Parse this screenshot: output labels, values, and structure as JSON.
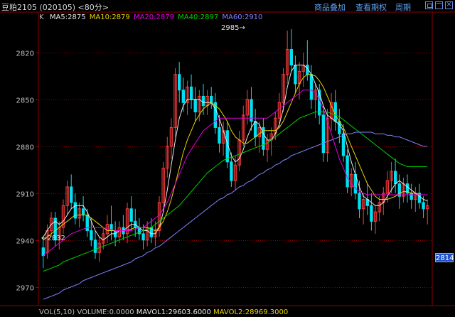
{
  "window": {
    "title": "豆粕2105 (020105) <80分>",
    "buttons": {
      "overlay": "商品叠加",
      "futures": "查看期权",
      "close": "周期"
    }
  },
  "indicator": {
    "k_label": "K",
    "ma": [
      {
        "name": "MA5",
        "text": "MA5:2875",
        "value": 2875,
        "color": "#e8e8e8"
      },
      {
        "name": "MA10",
        "text": "MA10:2879",
        "value": 2879,
        "color": "#e8d400"
      },
      {
        "name": "MA20",
        "text": "MA20:2879",
        "value": 2879,
        "color": "#e000e0"
      },
      {
        "name": "MA40",
        "text": "MA40:2897",
        "value": 2897,
        "color": "#00d000"
      },
      {
        "name": "MA60",
        "text": "MA60:2910",
        "value": 2910,
        "color": "#8080ff"
      }
    ]
  },
  "annotations": {
    "high": "2985",
    "low": "2832"
  },
  "price_axis": {
    "ticks": [
      "2970",
      "2940",
      "2910",
      "2880",
      "2850",
      "2820"
    ],
    "current": "2814"
  },
  "volume_legend": {
    "vol": "VOL(5,10)",
    "volume": "VOLUME:0.0000",
    "mavol1": "MAVOL1:29603.6000",
    "mavol2": "MAVOL2:28969.3000"
  },
  "colors": {
    "up": "#ff3c3c",
    "down": "#00e0f0",
    "grid": "#8c0000",
    "axis_text": "#c0c0c0",
    "tag_bg": "#1f50c8"
  },
  "chart_data": {
    "type": "candlestick",
    "ylim": [
      2808,
      2990
    ],
    "yticks": [
      2820,
      2850,
      2880,
      2910,
      2940,
      2970
    ],
    "candles": [
      [
        2845,
        2852,
        2832,
        2840
      ],
      [
        2842,
        2860,
        2838,
        2856
      ],
      [
        2856,
        2868,
        2852,
        2864
      ],
      [
        2864,
        2868,
        2846,
        2850
      ],
      [
        2850,
        2862,
        2844,
        2858
      ],
      [
        2858,
        2876,
        2854,
        2872
      ],
      [
        2872,
        2888,
        2866,
        2884
      ],
      [
        2884,
        2892,
        2870,
        2874
      ],
      [
        2874,
        2880,
        2860,
        2864
      ],
      [
        2864,
        2874,
        2858,
        2870
      ],
      [
        2870,
        2878,
        2862,
        2866
      ],
      [
        2866,
        2870,
        2852,
        2856
      ],
      [
        2856,
        2864,
        2846,
        2850
      ],
      [
        2850,
        2856,
        2838,
        2842
      ],
      [
        2842,
        2852,
        2836,
        2848
      ],
      [
        2848,
        2858,
        2844,
        2854
      ],
      [
        2854,
        2866,
        2848,
        2860
      ],
      [
        2860,
        2872,
        2850,
        2856
      ],
      [
        2856,
        2862,
        2846,
        2852
      ],
      [
        2852,
        2862,
        2848,
        2858
      ],
      [
        2858,
        2866,
        2850,
        2854
      ],
      [
        2854,
        2874,
        2848,
        2870
      ],
      [
        2870,
        2878,
        2856,
        2862
      ],
      [
        2862,
        2870,
        2852,
        2858
      ],
      [
        2858,
        2864,
        2850,
        2854
      ],
      [
        2854,
        2860,
        2844,
        2850
      ],
      [
        2850,
        2862,
        2846,
        2858
      ],
      [
        2858,
        2864,
        2848,
        2852
      ],
      [
        2852,
        2862,
        2846,
        2856
      ],
      [
        2856,
        2878,
        2852,
        2874
      ],
      [
        2874,
        2900,
        2868,
        2896
      ],
      [
        2896,
        2916,
        2890,
        2910
      ],
      [
        2910,
        2928,
        2902,
        2922
      ],
      [
        2922,
        2960,
        2916,
        2956
      ],
      [
        2956,
        2964,
        2938,
        2946
      ],
      [
        2946,
        2954,
        2932,
        2938
      ],
      [
        2938,
        2952,
        2930,
        2948
      ],
      [
        2948,
        2956,
        2934,
        2940
      ],
      [
        2940,
        2948,
        2926,
        2932
      ],
      [
        2932,
        2946,
        2926,
        2942
      ],
      [
        2942,
        2950,
        2930,
        2936
      ],
      [
        2936,
        2946,
        2930,
        2942
      ],
      [
        2942,
        2948,
        2934,
        2938
      ],
      [
        2938,
        2944,
        2918,
        2922
      ],
      [
        2922,
        2930,
        2906,
        2912
      ],
      [
        2912,
        2926,
        2904,
        2920
      ],
      [
        2920,
        2926,
        2896,
        2900
      ],
      [
        2900,
        2906,
        2884,
        2888
      ],
      [
        2888,
        2904,
        2882,
        2898
      ],
      [
        2898,
        2920,
        2894,
        2914
      ],
      [
        2914,
        2936,
        2910,
        2930
      ],
      [
        2930,
        2946,
        2924,
        2940
      ],
      [
        2940,
        2948,
        2920,
        2926
      ],
      [
        2926,
        2934,
        2910,
        2916
      ],
      [
        2916,
        2926,
        2906,
        2922
      ],
      [
        2922,
        2928,
        2904,
        2908
      ],
      [
        2908,
        2918,
        2900,
        2914
      ],
      [
        2914,
        2922,
        2904,
        2918
      ],
      [
        2918,
        2932,
        2914,
        2928
      ],
      [
        2928,
        2944,
        2922,
        2938
      ],
      [
        2938,
        2960,
        2932,
        2956
      ],
      [
        2956,
        2984,
        2950,
        2972
      ],
      [
        2972,
        2985,
        2958,
        2962
      ],
      [
        2962,
        2968,
        2944,
        2950
      ],
      [
        2950,
        2964,
        2940,
        2958
      ],
      [
        2958,
        2970,
        2948,
        2962
      ],
      [
        2962,
        2978,
        2952,
        2956
      ],
      [
        2956,
        2962,
        2934,
        2940
      ],
      [
        2940,
        2950,
        2928,
        2946
      ],
      [
        2946,
        2950,
        2924,
        2930
      ],
      [
        2930,
        2936,
        2900,
        2906
      ],
      [
        2906,
        2934,
        2900,
        2928
      ],
      [
        2928,
        2944,
        2920,
        2938
      ],
      [
        2938,
        2946,
        2920,
        2926
      ],
      [
        2926,
        2934,
        2912,
        2918
      ],
      [
        2918,
        2924,
        2900,
        2904
      ],
      [
        2904,
        2908,
        2880,
        2884
      ],
      [
        2884,
        2896,
        2878,
        2892
      ],
      [
        2892,
        2900,
        2876,
        2880
      ],
      [
        2880,
        2888,
        2864,
        2870
      ],
      [
        2870,
        2880,
        2860,
        2876
      ],
      [
        2876,
        2886,
        2866,
        2872
      ],
      [
        2872,
        2880,
        2856,
        2862
      ],
      [
        2862,
        2872,
        2854,
        2868
      ],
      [
        2868,
        2878,
        2862,
        2874
      ],
      [
        2874,
        2884,
        2866,
        2880
      ],
      [
        2880,
        2894,
        2874,
        2888
      ],
      [
        2888,
        2900,
        2880,
        2894
      ],
      [
        2894,
        2902,
        2880,
        2886
      ],
      [
        2886,
        2892,
        2870,
        2878
      ],
      [
        2878,
        2890,
        2874,
        2886
      ],
      [
        2886,
        2892,
        2874,
        2880
      ],
      [
        2880,
        2886,
        2870,
        2876
      ],
      [
        2876,
        2884,
        2868,
        2880
      ],
      [
        2880,
        2886,
        2870,
        2874
      ],
      [
        2874,
        2878,
        2864,
        2870
      ],
      [
        2870,
        2876,
        2860,
        2872
      ]
    ],
    "ma_lines": {
      "MA5": [
        2852,
        2856,
        2860,
        2862,
        2860,
        2862,
        2866,
        2870,
        2872,
        2872,
        2872,
        2868,
        2862,
        2856,
        2852,
        2850,
        2852,
        2854,
        2854,
        2856,
        2856,
        2858,
        2860,
        2860,
        2858,
        2856,
        2856,
        2854,
        2854,
        2858,
        2868,
        2882,
        2898,
        2914,
        2928,
        2936,
        2940,
        2940,
        2940,
        2940,
        2938,
        2938,
        2938,
        2934,
        2928,
        2920,
        2912,
        2904,
        2900,
        2902,
        2908,
        2916,
        2922,
        2926,
        2924,
        2918,
        2914,
        2914,
        2918,
        2924,
        2934,
        2948,
        2958,
        2962,
        2962,
        2962,
        2960,
        2956,
        2950,
        2944,
        2936,
        2930,
        2928,
        2926,
        2924,
        2920,
        2910,
        2900,
        2892,
        2884,
        2878,
        2876,
        2874,
        2872,
        2872,
        2874,
        2878,
        2882,
        2886,
        2888,
        2886,
        2884,
        2882,
        2880,
        2878,
        2876,
        2875
      ],
      "MA10": [
        2850,
        2852,
        2854,
        2856,
        2858,
        2860,
        2862,
        2864,
        2866,
        2866,
        2866,
        2866,
        2864,
        2862,
        2860,
        2858,
        2856,
        2856,
        2856,
        2856,
        2856,
        2856,
        2857,
        2858,
        2858,
        2858,
        2858,
        2857,
        2856,
        2858,
        2862,
        2868,
        2876,
        2886,
        2896,
        2906,
        2914,
        2920,
        2926,
        2930,
        2934,
        2936,
        2938,
        2936,
        2934,
        2930,
        2926,
        2920,
        2916,
        2914,
        2912,
        2912,
        2914,
        2916,
        2918,
        2920,
        2920,
        2920,
        2920,
        2922,
        2926,
        2932,
        2938,
        2944,
        2950,
        2954,
        2956,
        2956,
        2955,
        2952,
        2948,
        2942,
        2936,
        2930,
        2926,
        2922,
        2916,
        2910,
        2904,
        2898,
        2892,
        2886,
        2882,
        2878,
        2876,
        2876,
        2876,
        2877,
        2878,
        2880,
        2881,
        2881,
        2880,
        2880,
        2879,
        2879,
        2879
      ],
      "MA20": [
        2840,
        2842,
        2844,
        2846,
        2848,
        2850,
        2852,
        2854,
        2855,
        2856,
        2857,
        2858,
        2858,
        2858,
        2858,
        2858,
        2857,
        2857,
        2856,
        2856,
        2856,
        2856,
        2856,
        2857,
        2858,
        2858,
        2860,
        2862,
        2864,
        2866,
        2870,
        2874,
        2880,
        2886,
        2892,
        2898,
        2904,
        2908,
        2912,
        2916,
        2920,
        2922,
        2924,
        2926,
        2928,
        2928,
        2928,
        2928,
        2928,
        2928,
        2928,
        2928,
        2928,
        2928,
        2928,
        2928,
        2928,
        2930,
        2932,
        2934,
        2936,
        2938,
        2940,
        2942,
        2944,
        2946,
        2946,
        2946,
        2944,
        2940,
        2934,
        2926,
        2918,
        2910,
        2902,
        2896,
        2890,
        2886,
        2883,
        2881,
        2880,
        2879,
        2879,
        2879,
        2879,
        2879,
        2879,
        2879,
        2879,
        2879,
        2879,
        2879,
        2879,
        2879,
        2879,
        2879,
        2879
      ],
      "MA40": [
        2830,
        2831,
        2832,
        2833,
        2834,
        2836,
        2837,
        2838,
        2839,
        2840,
        2841,
        2842,
        2843,
        2844,
        2845,
        2846,
        2847,
        2848,
        2849,
        2850,
        2851,
        2852,
        2853,
        2854,
        2855,
        2856,
        2857,
        2858,
        2860,
        2862,
        2864,
        2866,
        2868,
        2870,
        2872,
        2875,
        2878,
        2881,
        2884,
        2887,
        2890,
        2893,
        2895,
        2897,
        2899,
        2901,
        2902,
        2903,
        2904,
        2905,
        2906,
        2907,
        2908,
        2909,
        2910,
        2911,
        2912,
        2914,
        2916,
        2918,
        2920,
        2922,
        2924,
        2926,
        2928,
        2929,
        2930,
        2931,
        2932,
        2932,
        2932,
        2932,
        2931,
        2930,
        2929,
        2927,
        2925,
        2923,
        2921,
        2919,
        2917,
        2915,
        2913,
        2911,
        2909,
        2907,
        2905,
        2903,
        2901,
        2899,
        2898,
        2897,
        2897,
        2897,
        2897,
        2897,
        2897
      ],
      "MA60": [
        2812,
        2813,
        2814,
        2815,
        2816,
        2818,
        2819,
        2820,
        2821,
        2822,
        2824,
        2825,
        2826,
        2827,
        2828,
        2829,
        2830,
        2831,
        2832,
        2833,
        2834,
        2835,
        2836,
        2838,
        2839,
        2840,
        2842,
        2843,
        2845,
        2846,
        2848,
        2850,
        2852,
        2854,
        2856,
        2858,
        2860,
        2862,
        2864,
        2866,
        2868,
        2870,
        2872,
        2874,
        2876,
        2877,
        2879,
        2880,
        2882,
        2884,
        2885,
        2887,
        2888,
        2890,
        2892,
        2893,
        2895,
        2896,
        2898,
        2899,
        2901,
        2902,
        2904,
        2905,
        2906,
        2907,
        2908,
        2909,
        2910,
        2911,
        2912,
        2913,
        2914,
        2915,
        2916,
        2917,
        2918,
        2918,
        2919,
        2919,
        2919,
        2919,
        2919,
        2918,
        2918,
        2918,
        2917,
        2917,
        2916,
        2916,
        2915,
        2914,
        2913,
        2912,
        2911,
        2910,
        2910
      ]
    }
  }
}
